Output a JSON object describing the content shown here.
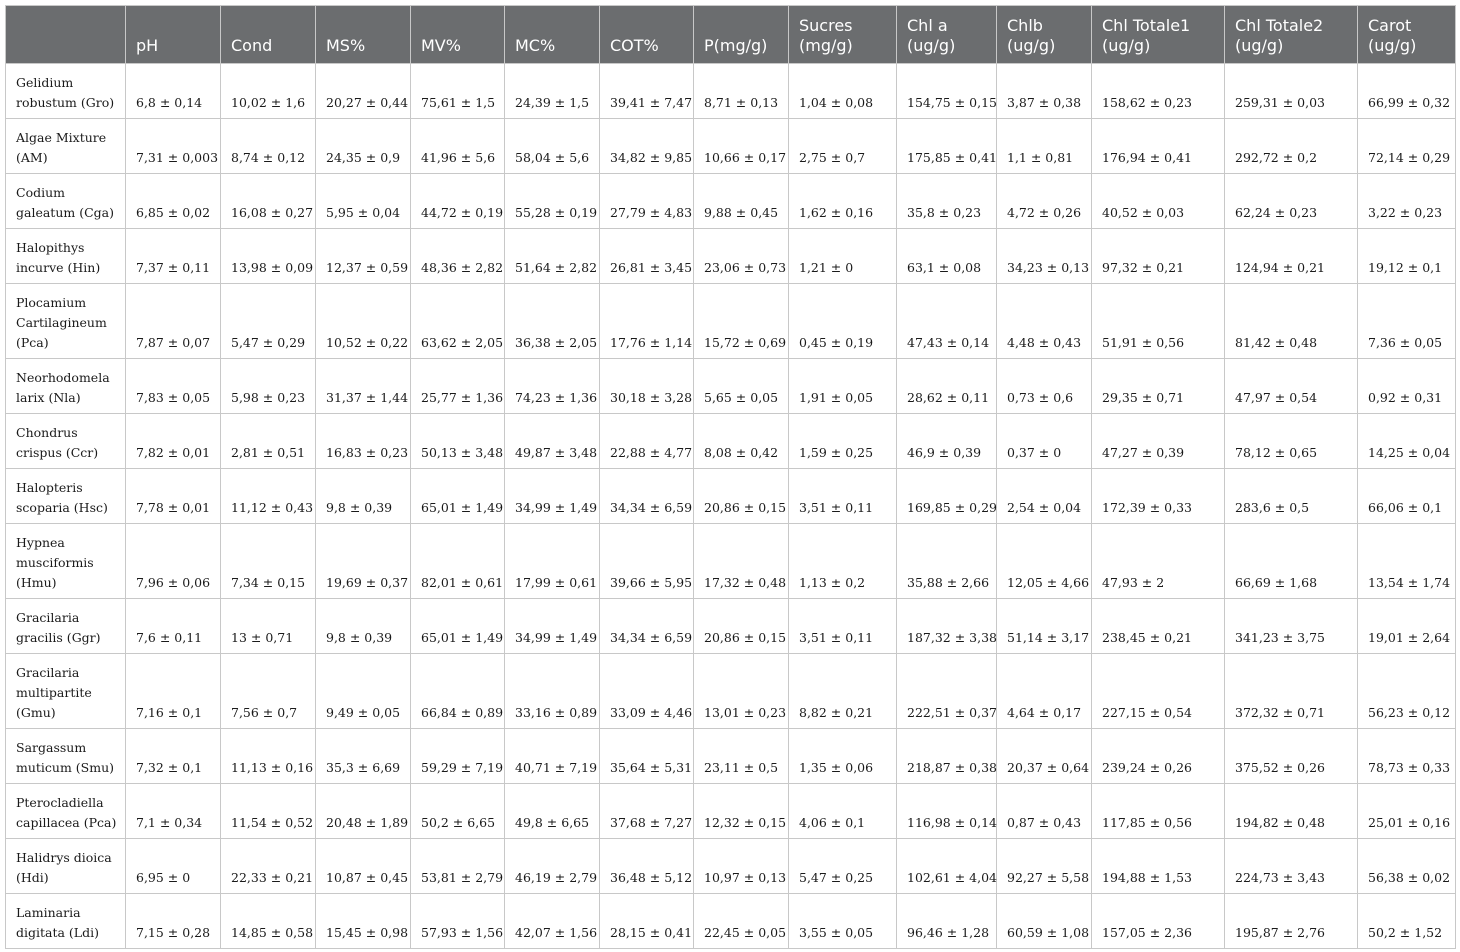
{
  "columns": [
    "",
    "pH",
    "Cond",
    "MS%",
    "MV%",
    "MC%",
    "COT%",
    "P(mg/g)",
    "Sucres (mg/g)",
    "Chl a (ug/g)",
    "Chlb (ug/g)",
    "Chl Totale1 (ug/g)",
    "Chl Totale2 (ug/g)",
    "Carot (ug/g)"
  ],
  "rows": [
    {
      "name": "Gelidium robustum (Gro)",
      "values": [
        "6,8 ± 0,14",
        "10,02 ± 1,6",
        "20,27 ± 0,44",
        "75,61 ± 1,5",
        "24,39 ± 1,5",
        "39,41 ± 7,47",
        "8,71 ± 0,13",
        "1,04 ± 0,08",
        "154,75 ± 0,15",
        "3,87 ± 0,38",
        "158,62 ± 0,23",
        "259,31 ± 0,03",
        "66,99 ± 0,32"
      ]
    },
    {
      "name": "Algae Mixture (AM)",
      "values": [
        "7,31 ± 0,003",
        "8,74 ± 0,12",
        "24,35 ± 0,9",
        "41,96 ± 5,6",
        "58,04 ± 5,6",
        "34,82 ± 9,85",
        "10,66 ± 0,17",
        "2,75 ± 0,7",
        "175,85 ± 0,41",
        "1,1 ± 0,81",
        "176,94 ± 0,41",
        "292,72 ± 0,2",
        "72,14 ± 0,29"
      ]
    },
    {
      "name": "Codium galeatum (Cga)",
      "values": [
        "6,85 ± 0,02",
        "16,08 ± 0,27",
        "5,95 ± 0,04",
        "44,72 ± 0,19",
        "55,28 ± 0,19",
        "27,79 ± 4,83",
        "9,88 ± 0,45",
        "1,62 ± 0,16",
        "35,8 ± 0,23",
        "4,72 ± 0,26",
        "40,52 ± 0,03",
        "62,24 ± 0,23",
        "3,22 ± 0,23"
      ]
    },
    {
      "name": "Halopithys incurve (Hin)",
      "values": [
        "7,37 ± 0,11",
        "13,98 ± 0,09",
        "12,37 ± 0,59",
        "48,36 ± 2,82",
        "51,64 ± 2,82",
        "26,81 ± 3,45",
        "23,06 ± 0,73",
        "1,21 ± 0",
        "63,1 ± 0,08",
        "34,23 ± 0,13",
        "97,32 ± 0,21",
        "124,94 ± 0,21",
        "19,12 ± 0,1"
      ]
    },
    {
      "name": "Plocamium Cartilagineum (Pca)",
      "values": [
        "7,87 ± 0,07",
        "5,47 ± 0,29",
        "10,52 ± 0,22",
        "63,62 ± 2,05",
        "36,38 ± 2,05",
        "17,76 ± 1,14",
        "15,72 ± 0,69",
        "0,45 ± 0,19",
        "47,43 ± 0,14",
        "4,48 ± 0,43",
        "51,91 ± 0,56",
        "81,42 ± 0,48",
        "7,36 ± 0,05"
      ]
    },
    {
      "name": "Neorhodomela larix (Nla)",
      "values": [
        "7,83 ± 0,05",
        "5,98 ± 0,23",
        "31,37 ± 1,44",
        "25,77 ± 1,36",
        "74,23 ± 1,36",
        "30,18 ± 3,28",
        "5,65 ± 0,05",
        "1,91 ± 0,05",
        "28,62 ± 0,11",
        "0,73 ± 0,6",
        "29,35 ± 0,71",
        "47,97 ± 0,54",
        "0,92 ± 0,31"
      ]
    },
    {
      "name": "Chondrus crispus (Ccr)",
      "values": [
        "7,82 ± 0,01",
        "2,81 ± 0,51",
        "16,83 ± 0,23",
        "50,13 ± 3,48",
        "49,87 ± 3,48",
        "22,88 ± 4,77",
        "8,08 ± 0,42",
        "1,59 ± 0,25",
        "46,9 ± 0,39",
        "0,37 ± 0",
        "47,27 ± 0,39",
        "78,12 ± 0,65",
        "14,25 ± 0,04"
      ]
    },
    {
      "name": "Halopteris scoparia (Hsc)",
      "values": [
        "7,78 ± 0,01",
        "11,12 ± 0,43",
        "9,8 ± 0,39",
        "65,01 ± 1,49",
        "34,99 ± 1,49",
        "34,34 ± 6,59",
        "20,86 ± 0,15",
        "3,51 ± 0,11",
        "169,85 ± 0,29",
        "2,54 ± 0,04",
        "172,39 ± 0,33",
        "283,6 ± 0,5",
        "66,06 ± 0,1"
      ]
    },
    {
      "name": "Hypnea musciformis (Hmu)",
      "values": [
        "7,96 ± 0,06",
        "7,34 ± 0,15",
        "19,69 ± 0,37",
        "82,01 ± 0,61",
        "17,99 ± 0,61",
        "39,66 ± 5,95",
        "17,32 ± 0,48",
        "1,13 ± 0,2",
        "35,88 ± 2,66",
        "12,05 ± 4,66",
        "47,93 ± 2",
        "66,69 ± 1,68",
        "13,54 ± 1,74"
      ]
    },
    {
      "name": "Gracilaria gracilis (Ggr)",
      "values": [
        "7,6 ± 0,11",
        "13 ± 0,71",
        "9,8 ± 0,39",
        "65,01 ± 1,49",
        "34,99 ± 1,49",
        "34,34 ± 6,59",
        "20,86 ± 0,15",
        "3,51 ± 0,11",
        "187,32 ± 3,38",
        "51,14 ± 3,17",
        "238,45 ± 0,21",
        "341,23 ± 3,75",
        "19,01 ± 2,64"
      ]
    },
    {
      "name": "Gracilaria multipartite (Gmu)",
      "values": [
        "7,16 ± 0,1",
        "7,56 ± 0,7",
        "9,49 ± 0,05",
        "66,84 ± 0,89",
        "33,16 ± 0,89",
        "33,09 ± 4,46",
        "13,01 ± 0,23",
        "8,82 ± 0,21",
        "222,51 ± 0,37",
        "4,64 ± 0,17",
        "227,15 ± 0,54",
        "372,32 ± 0,71",
        "56,23 ± 0,12"
      ]
    },
    {
      "name": "Sargassum muticum (Smu)",
      "values": [
        "7,32 ± 0,1",
        "11,13 ± 0,16",
        "35,3 ± 6,69",
        "59,29 ± 7,19",
        "40,71 ± 7,19",
        "35,64 ± 5,31",
        "23,11 ± 0,5",
        "1,35 ± 0,06",
        "218,87 ± 0,38",
        "20,37 ± 0,64",
        "239,24 ± 0,26",
        "375,52 ± 0,26",
        "78,73 ± 0,33"
      ]
    },
    {
      "name": "Pterocladiella capillacea (Pca)",
      "values": [
        "7,1 ± 0,34",
        "11,54 ± 0,52",
        "20,48 ± 1,89",
        "50,2 ± 6,65",
        "49,8 ± 6,65",
        "37,68 ± 7,27",
        "12,32 ± 0,15",
        "4,06 ± 0,1",
        "116,98 ± 0,14",
        "0,87 ± 0,43",
        "117,85 ± 0,56",
        "194,82 ± 0,48",
        "25,01 ± 0,16"
      ]
    },
    {
      "name": "Halidrys dioica (Hdi)",
      "values": [
        "6,95 ± 0",
        "22,33 ± 0,21",
        "10,87 ± 0,45",
        "53,81 ± 2,79",
        "46,19 ± 2,79",
        "36,48 ± 5,12",
        "10,97 ± 0,13",
        "5,47 ± 0,25",
        "102,61 ± 4,04",
        "92,27 ± 5,58",
        "194,88 ± 1,53",
        "224,73 ± 3,43",
        "56,38 ± 0,02"
      ]
    },
    {
      "name": "Laminaria digitata (Ldi)",
      "values": [
        "7,15 ± 0,28",
        "14,85 ± 0,58",
        "15,45 ± 0,98",
        "57,93 ± 1,56",
        "42,07 ± 1,56",
        "28,15 ± 0,41",
        "22,45 ± 0,05",
        "3,55 ± 0,05",
        "96,46 ± 1,28",
        "60,59 ± 1,08",
        "157,05 ± 2,36",
        "195,87 ± 2,76",
        "50,2 ± 1,52"
      ]
    }
  ]
}
